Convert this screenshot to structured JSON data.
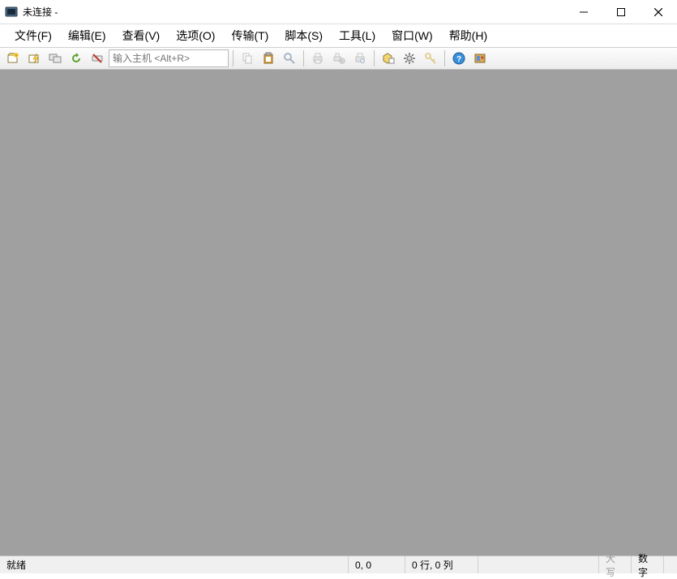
{
  "titlebar": {
    "title": "未连接 -"
  },
  "menu": {
    "file": "文件(F)",
    "edit": "编辑(E)",
    "view": "查看(V)",
    "options": "选项(O)",
    "transfer": "传输(T)",
    "script": "脚本(S)",
    "tools": "工具(L)",
    "window": "窗口(W)",
    "help": "帮助(H)"
  },
  "toolbar": {
    "host_placeholder": "输入主机 <Alt+R>"
  },
  "status": {
    "ready": "就绪",
    "pos": "0, 0",
    "rowcol": "0 行, 0 列",
    "caps": "大写",
    "num": "数字"
  }
}
